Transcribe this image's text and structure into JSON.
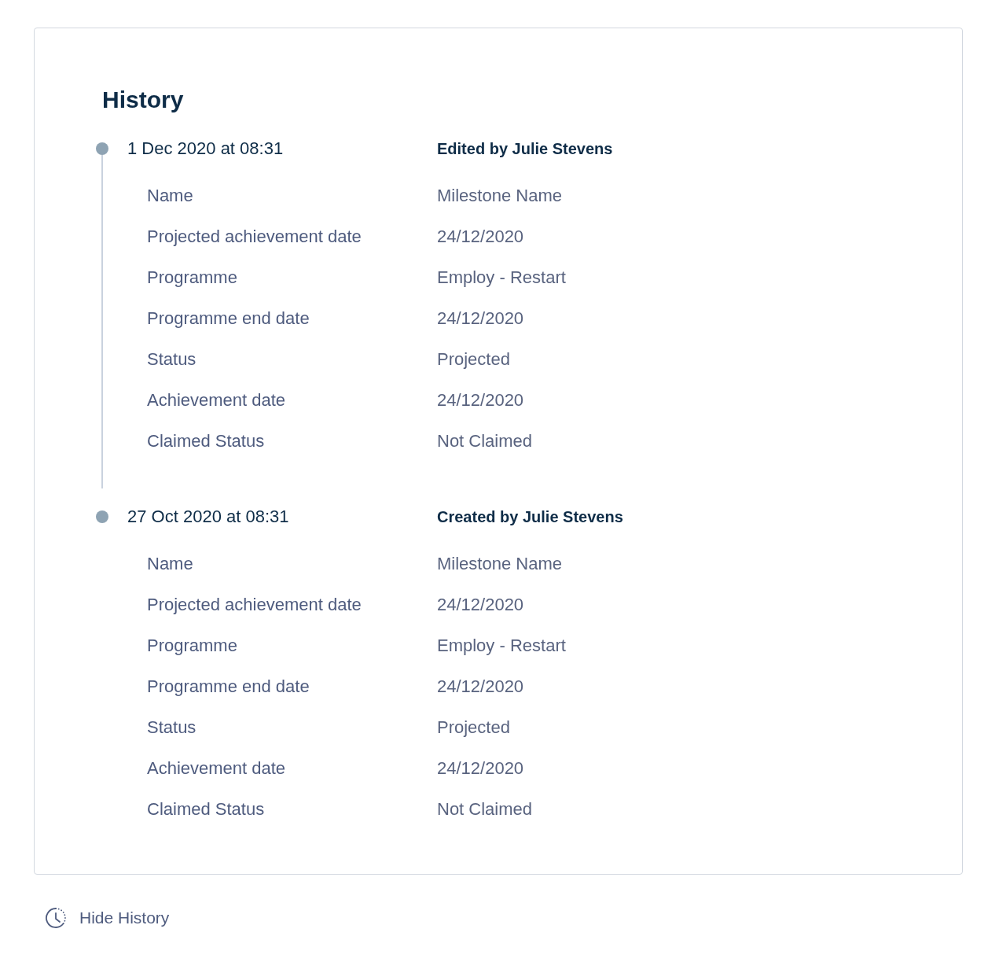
{
  "title": "History",
  "entries": [
    {
      "date": "1 Dec 2020 at 08:31",
      "author": "Edited by Julie Stevens",
      "fields": [
        {
          "label": "Name",
          "value": "Milestone Name"
        },
        {
          "label": "Projected achievement date",
          "value": "24/12/2020"
        },
        {
          "label": "Programme",
          "value": "Employ - Restart"
        },
        {
          "label": "Programme end date",
          "value": "24/12/2020"
        },
        {
          "label": "Status",
          "value": "Projected"
        },
        {
          "label": "Achievement date",
          "value": "24/12/2020"
        },
        {
          "label": "Claimed Status",
          "value": "Not Claimed"
        }
      ]
    },
    {
      "date": "27 Oct 2020 at 08:31",
      "author": "Created by Julie Stevens",
      "fields": [
        {
          "label": "Name",
          "value": "Milestone Name"
        },
        {
          "label": "Projected achievement date",
          "value": "24/12/2020"
        },
        {
          "label": "Programme",
          "value": "Employ - Restart"
        },
        {
          "label": "Programme end date",
          "value": "24/12/2020"
        },
        {
          "label": "Status",
          "value": "Projected"
        },
        {
          "label": "Achievement date",
          "value": "24/12/2020"
        },
        {
          "label": "Claimed Status",
          "value": "Not Claimed"
        }
      ]
    }
  ],
  "toggle": {
    "label": "Hide History"
  }
}
